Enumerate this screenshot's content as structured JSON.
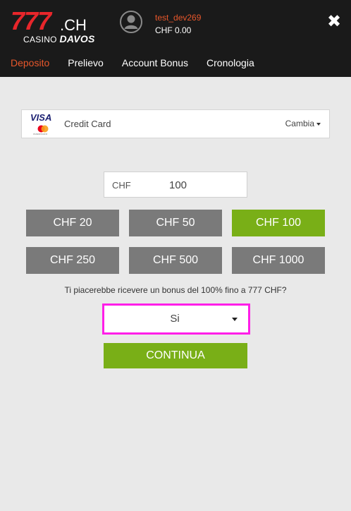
{
  "header": {
    "logo": {
      "main": "777",
      "suffix": ".CH",
      "sub_prefix": "CASINO",
      "sub_brand": "DAVOS"
    },
    "user": {
      "name": "test_dev269",
      "balance": "CHF 0.00"
    },
    "close_icon": "close-icon"
  },
  "nav": {
    "items": [
      {
        "label": "Deposito",
        "active": true
      },
      {
        "label": "Prelievo",
        "active": false
      },
      {
        "label": "Account Bonus",
        "active": false
      },
      {
        "label": "Cronologia",
        "active": false
      }
    ]
  },
  "payment_method": {
    "brand_visa": "VISA",
    "brand_mastercard": "mastercard",
    "label": "Credit Card",
    "change_label": "Cambia"
  },
  "amount": {
    "currency": "CHF",
    "value": "100"
  },
  "presets": [
    {
      "label": "CHF 20",
      "selected": false
    },
    {
      "label": "CHF 50",
      "selected": false
    },
    {
      "label": "CHF 100",
      "selected": true
    },
    {
      "label": "CHF 250",
      "selected": false
    },
    {
      "label": "CHF 500",
      "selected": false
    },
    {
      "label": "CHF 1000",
      "selected": false
    }
  ],
  "bonus": {
    "question": "Ti piacerebbe ricevere un bonus del 100% fino a 777 CHF?",
    "selected": "Si"
  },
  "continue_label": "CONTINUA",
  "colors": {
    "accent_green": "#79af17",
    "accent_orange": "#e8572b",
    "brand_red": "#e8262b",
    "highlight_magenta": "#ff1ee8"
  }
}
